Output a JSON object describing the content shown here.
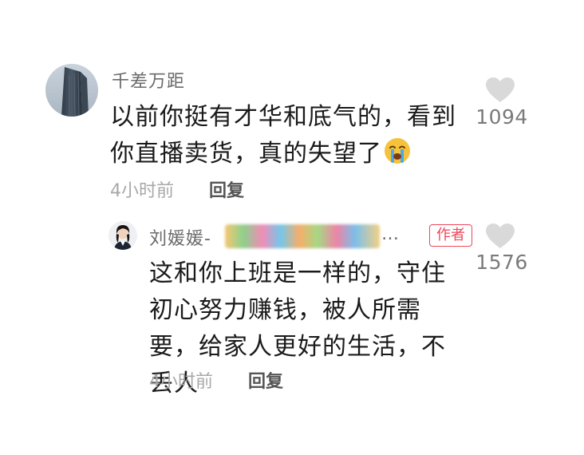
{
  "comment": {
    "username": "千差万距",
    "text": "以前你挺有才华和底气的，看到你直播卖货，真的失望了",
    "emoji": "loudly-crying-face-emoji",
    "time": "4小时前",
    "reply_label": "回复",
    "like_count": "1094",
    "avatar": "building-photo-avatar"
  },
  "reply": {
    "username_prefix": "刘媛媛-",
    "username_suffix": "…",
    "author_badge": "作者",
    "text": "这和你上班是一样的，守住初心努力赚钱，被人所需要，给家人更好的生活，不丢人",
    "time": "4小时前",
    "reply_label": "回复",
    "like_count": "1576",
    "avatar": "woman-portrait-avatar"
  },
  "colors": {
    "text_primary": "#1a1a1a",
    "text_secondary": "#6b6b6b",
    "text_meta": "#a8a8a8",
    "like_icon": "#d9d9d9",
    "author_badge": "#f0455a",
    "background": "#ffffff"
  }
}
